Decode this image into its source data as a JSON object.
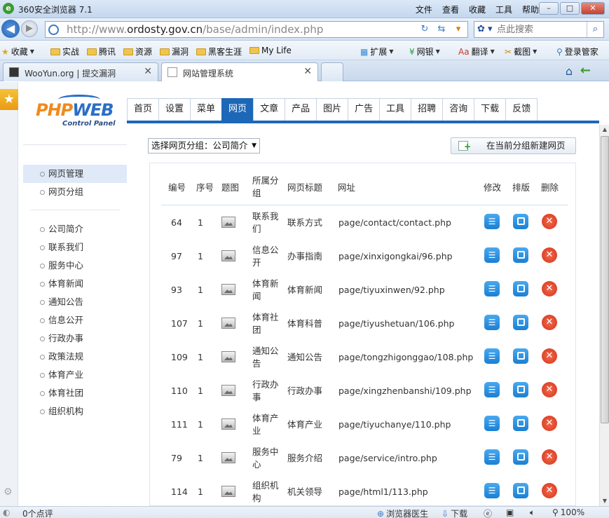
{
  "browser": {
    "title": "360安全浏览器 7.1",
    "menu": [
      "文件",
      "查看",
      "收藏",
      "工具",
      "帮助"
    ],
    "url_prefix": "http://www.",
    "url_domain": "ordosty.gov.cn",
    "url_path": "/base/admin/index.php",
    "search_placeholder": "点此搜索",
    "bookmarks": [
      "收藏",
      "实战",
      "腾讯",
      "资源",
      "漏洞",
      "黑客生涯",
      "My Life"
    ],
    "extras": [
      "扩展",
      "网银",
      "翻译",
      "截图",
      "登录管家"
    ],
    "tabs": [
      {
        "label": "WooYun.org | 提交漏洞"
      },
      {
        "label": "网站管理系统"
      }
    ]
  },
  "logo": {
    "main_a": "PHP",
    "main_b": "WEB",
    "sub": "Control Panel"
  },
  "leftnav": {
    "top": [
      "网页管理",
      "网页分组"
    ],
    "groups": [
      "公司简介",
      "联系我们",
      "服务中心",
      "体育新闻",
      "通知公告",
      "信息公开",
      "行政办事",
      "政策法规",
      "体育产业",
      "体育社团",
      "组织机构"
    ]
  },
  "topnav": [
    "首页",
    "设置",
    "菜单",
    "网页",
    "文章",
    "产品",
    "图片",
    "广告",
    "工具",
    "招聘",
    "咨询",
    "下载",
    "反馈"
  ],
  "toolbar": {
    "group_select": "选择网页分组：公司简介",
    "new_button": "在当前分组新建网页"
  },
  "table": {
    "headers": {
      "id": "编号",
      "seq": "序号",
      "img": "题图",
      "cat_a": "所属分",
      "cat_b": "组",
      "title": "网页标题",
      "url": "网址",
      "edit": "修改",
      "layout": "排版",
      "del": "删除"
    },
    "rows": [
      {
        "id": "64",
        "seq": "1",
        "cat_a": "联系我",
        "cat_b": "们",
        "title": "联系方式",
        "url": "page/contact/contact.php"
      },
      {
        "id": "97",
        "seq": "1",
        "cat_a": "信息公",
        "cat_b": "开",
        "title": "办事指南",
        "url": "page/xinxigongkai/96.php"
      },
      {
        "id": "93",
        "seq": "1",
        "cat_a": "体育新",
        "cat_b": "闻",
        "title": "体育新闻",
        "url": "page/tiyuxinwen/92.php"
      },
      {
        "id": "107",
        "seq": "1",
        "cat_a": "体育社",
        "cat_b": "团",
        "title": "体育科普",
        "url": "page/tiyushetuan/106.php"
      },
      {
        "id": "109",
        "seq": "1",
        "cat_a": "通知公",
        "cat_b": "告",
        "title": "通知公告",
        "url": "page/tongzhigonggao/108.php"
      },
      {
        "id": "110",
        "seq": "1",
        "cat_a": "行政办",
        "cat_b": "事",
        "title": "行政办事",
        "url": "page/xingzhenbanshi/109.php"
      },
      {
        "id": "111",
        "seq": "1",
        "cat_a": "体育产",
        "cat_b": "业",
        "title": "体育产业",
        "url": "page/tiyuchanye/110.php"
      },
      {
        "id": "79",
        "seq": "1",
        "cat_a": "服务中",
        "cat_b": "心",
        "title": "服务介绍",
        "url": "page/service/intro.php"
      },
      {
        "id": "114",
        "seq": "1",
        "cat_a": "组织机",
        "cat_b": "构",
        "title": "机关领导",
        "url": "page/html1/113.php"
      }
    ]
  },
  "status": {
    "comments": "0个点评",
    "doctor": "浏览器医生",
    "download": "下载",
    "zoom": "100%"
  }
}
